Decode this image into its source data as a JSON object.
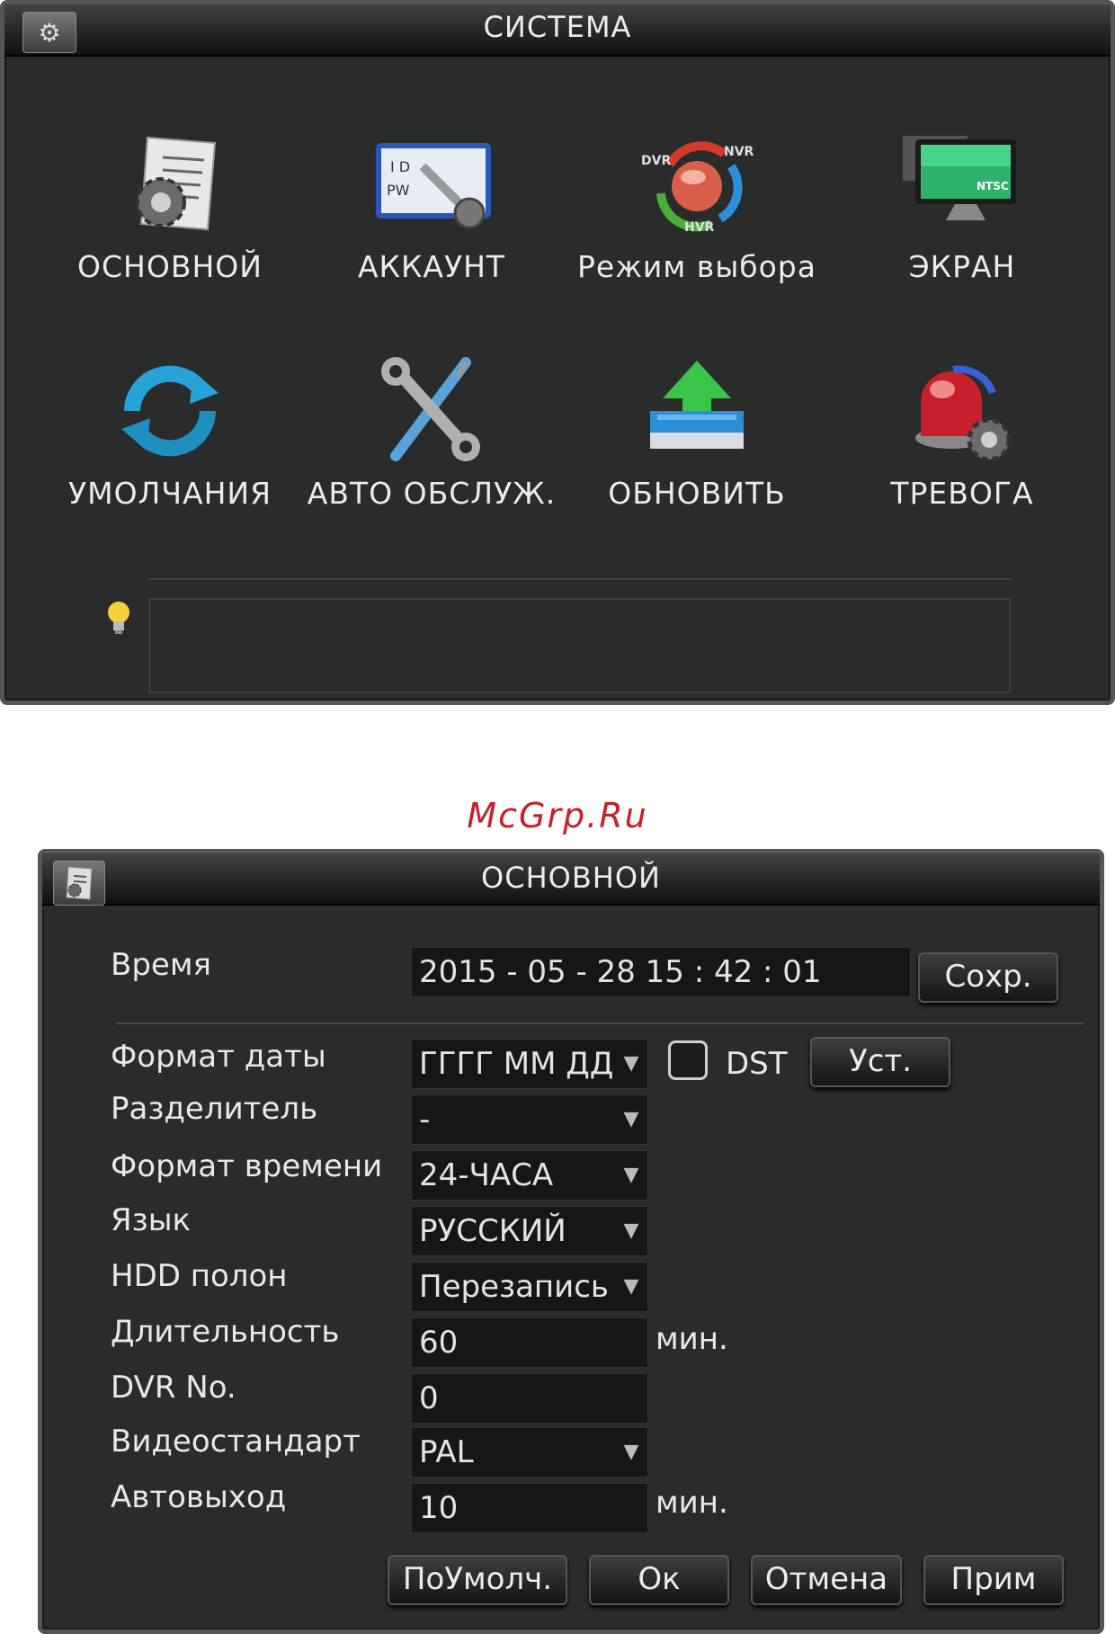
{
  "system": {
    "title": "СИСТЕМА",
    "title_icon": "gears-icon",
    "tiles": [
      {
        "label": "ОСНОВНОЙ",
        "icon": "general-settings-icon"
      },
      {
        "label": "АККАУНТ",
        "icon": "account-icon"
      },
      {
        "label": "Режим выбора",
        "icon": "mode-select-icon"
      },
      {
        "label": "ЭКРАН",
        "icon": "display-icon"
      },
      {
        "label": "УМОЛЧАНИЯ",
        "icon": "default-refresh-icon"
      },
      {
        "label": "АВТО ОБСЛУЖ.",
        "icon": "wrench-tools-icon"
      },
      {
        "label": "ОБНОВИТЬ",
        "icon": "upgrade-icon"
      },
      {
        "label": "ТРЕВОГА",
        "icon": "alarm-icon"
      }
    ],
    "mode_icon_labels": {
      "dvr": "DVR",
      "nvr": "NVR",
      "hvr": "HVR"
    },
    "display_icon_label": "NTSC",
    "account_icon_labels": {
      "id": "I D",
      "pw": "PW"
    },
    "hint_text": ""
  },
  "watermark": "McGrp.Ru",
  "basic": {
    "title": "ОСНОВНОЙ",
    "title_icon": "document-settings-icon",
    "time": {
      "label": "Время",
      "value": "2015  - 05 - 28    15 : 42 : 01",
      "save_button": "Сохр."
    },
    "date_format": {
      "label": "Формат даты",
      "value": "ГГГГ ММ ДД",
      "dst_label": "DST",
      "dst_checked": false,
      "set_button": "Уст."
    },
    "separator": {
      "label": "Разделитель",
      "value": "-"
    },
    "time_format": {
      "label": "Формат времени",
      "value": "24-ЧАСА"
    },
    "language": {
      "label": "Язык",
      "value": "РУССКИЙ"
    },
    "hdd_full": {
      "label": "HDD полон",
      "value": "Перезапись"
    },
    "duration": {
      "label": "Длительность",
      "value": "60",
      "unit": "мин."
    },
    "dvr_no": {
      "label": "DVR No.",
      "value": "0"
    },
    "video_standard": {
      "label": "Видеостандарт",
      "value": "PAL"
    },
    "auto_logout": {
      "label": "Автовыход",
      "value": "10",
      "unit": "мин."
    },
    "buttons": {
      "default": "ПоУмолч.",
      "ok": "Ок",
      "cancel": "Отмена",
      "apply": "Прим"
    }
  }
}
